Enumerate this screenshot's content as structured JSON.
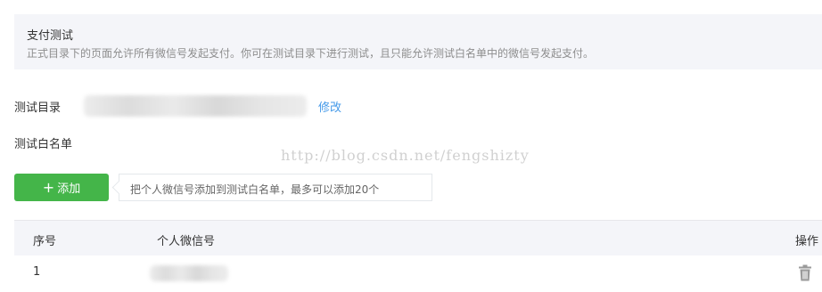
{
  "banner": {
    "title": "支付测试",
    "description": "正式目录下的页面允许所有微信号发起支付。你可在测试目录下进行测试，且只能允许测试白名单中的微信号发起支付。"
  },
  "test_directory": {
    "label": "测试目录",
    "modify_link": "修改"
  },
  "whitelist": {
    "label": "测试白名单",
    "add_button": "添加",
    "add_icon": "+",
    "hint": "把个人微信号添加到测试白名单，最多可以添加20个"
  },
  "watermark": "http://blog.csdn.net/fengshizty",
  "table": {
    "headers": [
      "序号",
      "个人微信号",
      "操作"
    ],
    "rows": [
      {
        "index": "1"
      }
    ]
  },
  "colors": {
    "accent_green": "#44b549",
    "link_blue": "#459ae9",
    "banner_bg": "#f4f5f9"
  },
  "icons": {
    "delete": "trash-icon",
    "add": "plus-icon"
  }
}
